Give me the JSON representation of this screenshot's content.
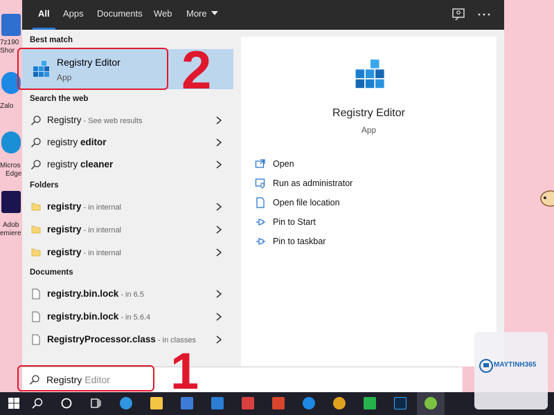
{
  "desktop": {
    "icons": [
      {
        "label": "7z190",
        "label2": "Shor",
        "color": "#2f6fd0"
      },
      {
        "label": "Zalo",
        "label2": "",
        "color": "#1e88e5"
      },
      {
        "label": "Micros",
        "label2": "Edge",
        "color": "#1a8fd6"
      },
      {
        "label": "Adob",
        "label2": "emiere",
        "color": "#1a1450"
      }
    ]
  },
  "tabs": [
    "All",
    "Apps",
    "Documents",
    "Web",
    "More"
  ],
  "best_match": {
    "section": "Best match",
    "title": "Registry Editor",
    "subtitle": "App"
  },
  "web": {
    "section": "Search the web",
    "items": [
      {
        "main": "Registry",
        "bold": "",
        "hint": " - See web results"
      },
      {
        "main": "registry ",
        "bold": "editor",
        "hint": ""
      },
      {
        "main": "registry ",
        "bold": "cleaner",
        "hint": ""
      }
    ]
  },
  "folders": {
    "section": "Folders",
    "items": [
      {
        "name": "registry",
        "hint": " - in internal"
      },
      {
        "name": "registry",
        "hint": " - in internal"
      },
      {
        "name": "registry",
        "hint": " - in internal"
      }
    ]
  },
  "documents": {
    "section": "Documents",
    "items": [
      {
        "name": "registry.bin.lock",
        "hint": " - in 6.5"
      },
      {
        "name": "registry.bin.lock",
        "hint": " - in 5.6.4"
      },
      {
        "name": "RegistryProcessor.class",
        "hint": " - in classes"
      }
    ]
  },
  "preview": {
    "name": "Registry Editor",
    "kind": "App",
    "actions": [
      "Open",
      "Run as administrator",
      "Open file location",
      "Pin to Start",
      "Pin to taskbar"
    ]
  },
  "search": {
    "typed": "Registry",
    "ghost": " Editor"
  },
  "annotations": {
    "step1": "1",
    "step2": "2",
    "color": "#e0182d"
  },
  "watermark": {
    "brand": "MAYTINH365"
  },
  "colors": {
    "accent": "#2e7ad6",
    "selected": "#bcd6ee",
    "topbar": "#2b2b2b",
    "taskbar": "#1f1f2a",
    "desktop": "#f6c5cf"
  }
}
